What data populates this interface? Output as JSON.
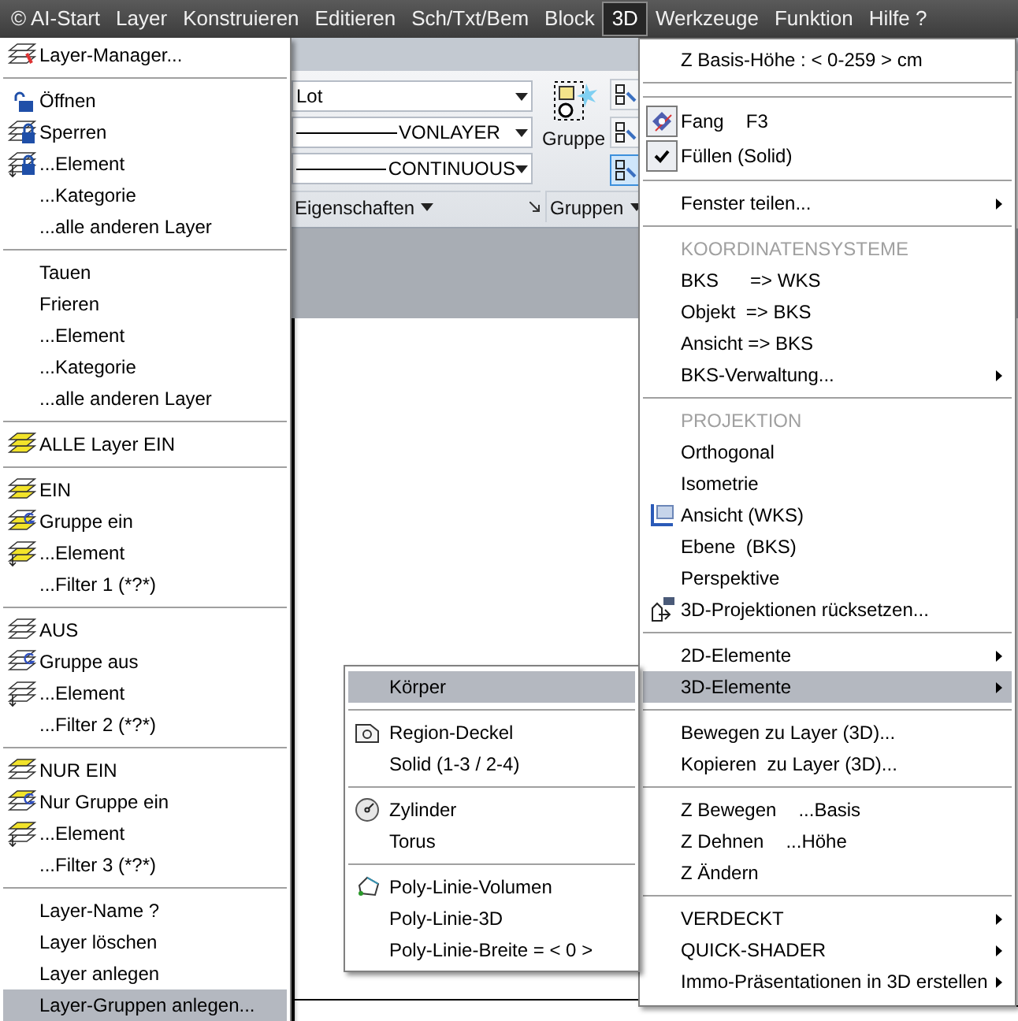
{
  "menu_bar": [
    {
      "label": "© AI-Start",
      "selected": false
    },
    {
      "label": "Layer",
      "selected": false
    },
    {
      "label": "Konstruieren",
      "selected": false
    },
    {
      "label": "Editieren",
      "selected": false
    },
    {
      "label": "Sch/Txt/Bem",
      "selected": false
    },
    {
      "label": "Block",
      "selected": false
    },
    {
      "label": "3D",
      "selected": true
    },
    {
      "label": "Werkzeuge",
      "selected": false
    },
    {
      "label": "Funktion",
      "selected": false
    },
    {
      "label": "Hilfe ?",
      "selected": false
    }
  ],
  "ribbon": {
    "fields": [
      {
        "value": "Lot"
      },
      {
        "value": "VONLAYER"
      },
      {
        "value": "CONTINUOUS"
      }
    ],
    "panels": [
      {
        "label": "Eigenschaften"
      },
      {
        "label": "Gruppen"
      }
    ],
    "group_button": {
      "label": "Gruppe"
    }
  },
  "layer_menu": [
    {
      "kind": "item",
      "label": "Layer-Manager...",
      "selected": false
    },
    {
      "kind": "separator"
    },
    {
      "kind": "item",
      "label": "Öffnen",
      "selected": false
    },
    {
      "kind": "item",
      "label": "Sperren",
      "selected": false
    },
    {
      "kind": "item",
      "label": "...Element",
      "selected": false
    },
    {
      "kind": "item",
      "label": "...Kategorie",
      "selected": false
    },
    {
      "kind": "item",
      "label": "...alle anderen Layer",
      "selected": false
    },
    {
      "kind": "separator"
    },
    {
      "kind": "item",
      "label": "Tauen",
      "selected": false
    },
    {
      "kind": "item",
      "label": "Frieren",
      "selected": false
    },
    {
      "kind": "item",
      "label": "...Element",
      "selected": false
    },
    {
      "kind": "item",
      "label": "...Kategorie",
      "selected": false
    },
    {
      "kind": "item",
      "label": "...alle anderen Layer",
      "selected": false
    },
    {
      "kind": "separator"
    },
    {
      "kind": "item",
      "label": "ALLE Layer EIN",
      "selected": false
    },
    {
      "kind": "separator"
    },
    {
      "kind": "item",
      "label": "EIN",
      "selected": false
    },
    {
      "kind": "item",
      "label": "Gruppe ein",
      "selected": false
    },
    {
      "kind": "item",
      "label": "...Element",
      "selected": false
    },
    {
      "kind": "item",
      "label": "...Filter 1 (*?*)",
      "selected": false
    },
    {
      "kind": "separator"
    },
    {
      "kind": "item",
      "label": "AUS",
      "selected": false
    },
    {
      "kind": "item",
      "label": "Gruppe aus",
      "selected": false
    },
    {
      "kind": "item",
      "label": "...Element",
      "selected": false
    },
    {
      "kind": "item",
      "label": "...Filter 2 (*?*)",
      "selected": false
    },
    {
      "kind": "separator"
    },
    {
      "kind": "item",
      "label": "NUR EIN",
      "selected": false
    },
    {
      "kind": "item",
      "label": "Nur Gruppe ein",
      "selected": false
    },
    {
      "kind": "item",
      "label": "...Element",
      "selected": false
    },
    {
      "kind": "item",
      "label": "...Filter 3 (*?*)",
      "selected": false
    },
    {
      "kind": "separator"
    },
    {
      "kind": "item",
      "label": "Layer-Name ?",
      "selected": false
    },
    {
      "kind": "item",
      "label": "Layer löschen",
      "selected": false
    },
    {
      "kind": "item",
      "label": "Layer anlegen",
      "selected": false
    },
    {
      "kind": "item",
      "label": "Layer-Gruppen anlegen...",
      "selected": true
    }
  ],
  "menu_3d": [
    {
      "kind": "item",
      "label": "Z Basis-Höhe : < 0-259 > cm",
      "selected": false,
      "checked": false,
      "submenu": false
    },
    {
      "kind": "separator"
    },
    {
      "kind": "separator"
    },
    {
      "kind": "item",
      "label": "Fang",
      "shortcut": "F3",
      "selected": false,
      "checked": true,
      "submenu": false
    },
    {
      "kind": "item",
      "label": "Füllen (Solid)",
      "selected": false,
      "checked": true,
      "submenu": false
    },
    {
      "kind": "separator"
    },
    {
      "kind": "item",
      "label": "Fenster teilen...",
      "selected": false,
      "checked": false,
      "submenu": true
    },
    {
      "kind": "separator"
    },
    {
      "kind": "heading",
      "label": "KOORDINATENSYSTEME"
    },
    {
      "kind": "item",
      "label": "BKS      => WKS",
      "selected": false,
      "checked": false,
      "submenu": false
    },
    {
      "kind": "item",
      "label": "Objekt  => BKS",
      "selected": false,
      "checked": false,
      "submenu": false
    },
    {
      "kind": "item",
      "label": "Ansicht => BKS",
      "selected": false,
      "checked": false,
      "submenu": false
    },
    {
      "kind": "item",
      "label": "BKS-Verwaltung...",
      "selected": false,
      "checked": false,
      "submenu": true
    },
    {
      "kind": "separator"
    },
    {
      "kind": "heading",
      "label": "PROJEKTION"
    },
    {
      "kind": "item",
      "label": "Orthogonal",
      "selected": false,
      "checked": false,
      "submenu": false
    },
    {
      "kind": "item",
      "label": "Isometrie",
      "selected": false,
      "checked": false,
      "submenu": false
    },
    {
      "kind": "item",
      "label": "Ansicht (WKS)",
      "selected": false,
      "checked": false,
      "submenu": false
    },
    {
      "kind": "item",
      "label": "Ebene  (BKS)",
      "selected": false,
      "checked": false,
      "submenu": false
    },
    {
      "kind": "item",
      "label": "Perspektive",
      "selected": false,
      "checked": false,
      "submenu": false
    },
    {
      "kind": "item",
      "label": "3D-Projektionen rücksetzen...",
      "selected": false,
      "checked": false,
      "submenu": false
    },
    {
      "kind": "separator"
    },
    {
      "kind": "item",
      "label": "2D-Elemente",
      "selected": false,
      "checked": false,
      "submenu": true
    },
    {
      "kind": "item",
      "label": "3D-Elemente",
      "selected": true,
      "checked": false,
      "submenu": true
    },
    {
      "kind": "separator"
    },
    {
      "kind": "item",
      "label": "Bewegen zu Layer (3D)...",
      "selected": false,
      "checked": false,
      "submenu": false
    },
    {
      "kind": "item",
      "label": "Kopieren  zu Layer (3D)...",
      "selected": false,
      "checked": false,
      "submenu": false
    },
    {
      "kind": "separator"
    },
    {
      "kind": "item",
      "label": "Z Bewegen",
      "shortcut": "...Basis",
      "selected": false,
      "checked": false,
      "submenu": false
    },
    {
      "kind": "item",
      "label": "Z Dehnen",
      "shortcut": "...Höhe",
      "selected": false,
      "checked": false,
      "submenu": false
    },
    {
      "kind": "item",
      "label": "Z Ändern",
      "selected": false,
      "checked": false,
      "submenu": false
    },
    {
      "kind": "separator"
    },
    {
      "kind": "item",
      "label": "VERDECKT",
      "selected": false,
      "checked": false,
      "submenu": true
    },
    {
      "kind": "item",
      "label": "QUICK-SHADER",
      "selected": false,
      "checked": false,
      "submenu": true
    },
    {
      "kind": "item",
      "label": "Immo-Präsentationen in 3D erstellen",
      "selected": false,
      "checked": false,
      "submenu": true
    }
  ],
  "submenu_3d_elemente": [
    {
      "kind": "item",
      "label": "Körper",
      "selected": true
    },
    {
      "kind": "separator"
    },
    {
      "kind": "item",
      "label": "Region-Deckel",
      "selected": false
    },
    {
      "kind": "item",
      "label": "Solid (1-3 / 2-4)",
      "selected": false
    },
    {
      "kind": "separator"
    },
    {
      "kind": "item",
      "label": "Zylinder",
      "selected": false
    },
    {
      "kind": "item",
      "label": "Torus",
      "selected": false
    },
    {
      "kind": "separator"
    },
    {
      "kind": "item",
      "label": "Poly-Linie-Volumen",
      "selected": false
    },
    {
      "kind": "item",
      "label": "Poly-Linie-3D",
      "selected": false
    },
    {
      "kind": "item",
      "label": "Poly-Linie-Breite = < 0 >",
      "selected": false
    }
  ]
}
